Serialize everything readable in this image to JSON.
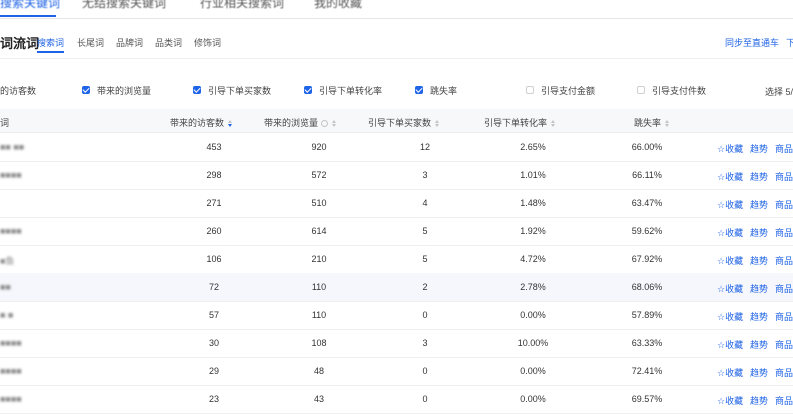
{
  "top_tabs": [
    {
      "label": "搜索关键词",
      "active": true
    },
    {
      "label": "无结搜索关键词",
      "active": false
    },
    {
      "label": "行业相关搜索词",
      "active": false
    },
    {
      "label": "我的收藏",
      "active": false
    }
  ],
  "section_title": "词流词",
  "sub_tabs": [
    "搜索词",
    "长尾词",
    "品牌词",
    "品类词",
    "修饰词"
  ],
  "sync_link": "同步至直通车",
  "sync_extra": "下",
  "metrics": [
    {
      "label": "的访客数",
      "checked": null
    },
    {
      "label": "带来的浏览量",
      "checked": true
    },
    {
      "label": "引导下单买家数",
      "checked": true
    },
    {
      "label": "引导下单转化率",
      "checked": true
    },
    {
      "label": "跳失率",
      "checked": true
    },
    {
      "label": "引导支付金额",
      "checked": false
    },
    {
      "label": "引导支付件数",
      "checked": false
    }
  ],
  "select_info": "选择 5/",
  "columns": [
    "词",
    "带来的访客数",
    "带来的浏览量",
    "引导下单买家数",
    "引导下单转化率",
    "跳失率"
  ],
  "rows": [
    {
      "keyword": "■■ ■■",
      "visitors": "453",
      "views": "920",
      "buyers": "12",
      "conv": "2.65%",
      "bounce": "66.00%"
    },
    {
      "keyword": "■■■■",
      "visitors": "298",
      "views": "572",
      "buyers": "3",
      "conv": "1.01%",
      "bounce": "66.11%"
    },
    {
      "keyword": "",
      "visitors": "271",
      "views": "510",
      "buyers": "4",
      "conv": "1.48%",
      "bounce": "63.47%"
    },
    {
      "keyword": "■■■■",
      "visitors": "260",
      "views": "614",
      "buyers": "5",
      "conv": "1.92%",
      "bounce": "59.62%"
    },
    {
      "keyword": "■鱼",
      "visitors": "106",
      "views": "210",
      "buyers": "5",
      "conv": "4.72%",
      "bounce": "67.92%"
    },
    {
      "keyword": "■■",
      "visitors": "72",
      "views": "110",
      "buyers": "2",
      "conv": "2.78%",
      "bounce": "68.06%"
    },
    {
      "keyword": "■ ■",
      "visitors": "57",
      "views": "110",
      "buyers": "0",
      "conv": "0.00%",
      "bounce": "57.89%"
    },
    {
      "keyword": "■■■■",
      "visitors": "30",
      "views": "108",
      "buyers": "3",
      "conv": "10.00%",
      "bounce": "63.33%"
    },
    {
      "keyword": "■■■■",
      "visitors": "29",
      "views": "48",
      "buyers": "0",
      "conv": "0.00%",
      "bounce": "72.41%"
    },
    {
      "keyword": "■■■■",
      "visitors": "23",
      "views": "43",
      "buyers": "0",
      "conv": "0.00%",
      "bounce": "69.57%"
    }
  ],
  "actions": {
    "collect": "☆收藏",
    "trend": "趋势",
    "product": "商品"
  },
  "highlighted_row": 5,
  "colors": {
    "accent": "#1f63e6",
    "header_bg": "#f7f8fa",
    "row_highlight": "#f5f7fc"
  }
}
